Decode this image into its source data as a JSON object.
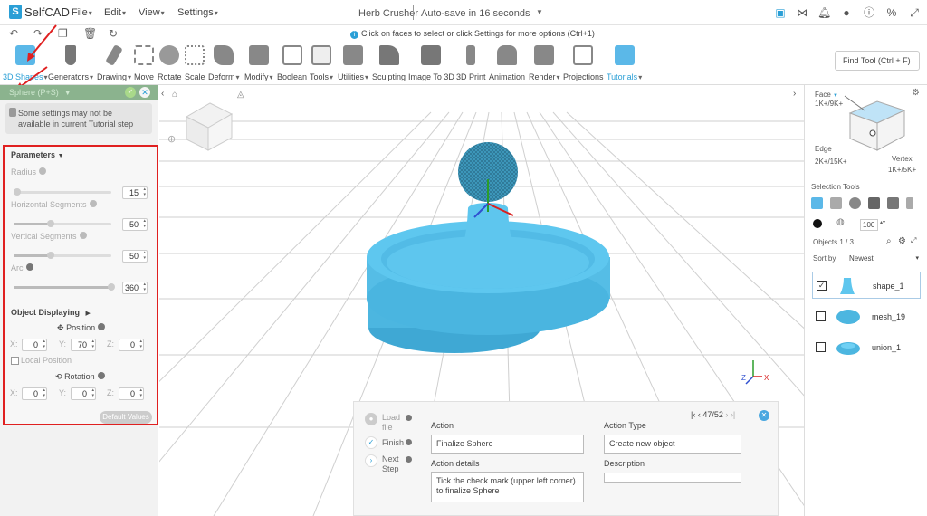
{
  "app": {
    "logo_text": "SelfCAD",
    "doc_title": "Herb Crusher",
    "autosave": "Auto-save in 16 seconds"
  },
  "menu": [
    "File",
    "Edit",
    "View",
    "Settings"
  ],
  "hint": "Click on faces to select or click Settings for more options (Ctrl+1)",
  "toolbar": {
    "tools": [
      "3D Shapes",
      "Generators",
      "Drawing",
      "Move",
      "Rotate",
      "Scale",
      "Deform",
      "Modify",
      "Boolean",
      "Tools",
      "Utilities",
      "Sculpting",
      "Image To 3D",
      "3D Print",
      "Animation",
      "Render",
      "Projections",
      "Tutorials"
    ],
    "find_tool": "Find Tool (Ctrl + F)"
  },
  "panel": {
    "title": "Sphere (P+S)",
    "notice": "Some settings may not be available in current Tutorial step",
    "parameters_title": "Parameters",
    "radius_label": "Radius",
    "radius": "15",
    "radius_level": 0.04,
    "hseg_label": "Horizontal Segments",
    "hseg": "50",
    "hseg_level": 0.38,
    "vseg_label": "Vertical Segments",
    "vseg": "50",
    "vseg_level": 0.38,
    "arc_label": "Arc",
    "arc": "360",
    "arc_level": 1.0,
    "object_displaying": "Object Displaying",
    "position_label": "Position",
    "pos_x": "0",
    "pos_y": "70",
    "pos_z": "0",
    "local_position": "Local Position",
    "rotation_label": "Rotation",
    "rot_x": "0",
    "rot_y": "0",
    "rot_z": "0",
    "default_values": "Default Values",
    "x": "X:",
    "y": "Y:",
    "z": "Z:"
  },
  "right": {
    "face": "Face",
    "face_count": "1K+/9K+",
    "edge": "Edge",
    "edge_count": "2K+/15K+",
    "vertex": "Vertex",
    "vertex_count": "1K+/5K+",
    "selection_tools": "Selection Tools",
    "opacity": "100",
    "objects": "Objects 1 / 3",
    "sort_by": "Sort by",
    "sort_value": "Newest",
    "items": [
      {
        "name": "shape_1",
        "checked": true
      },
      {
        "name": "mesh_19",
        "checked": false
      },
      {
        "name": "union_1",
        "checked": false
      }
    ]
  },
  "tutorial": {
    "steps": [
      "Load file",
      "Finish",
      "Next Step"
    ],
    "action_label": "Action",
    "action": "Finalize Sphere",
    "action_details_label": "Action details",
    "action_details": "Tick the check mark (upper left corner) to finalize Sphere",
    "action_type_label": "Action Type",
    "action_type": "Create new object",
    "description_label": "Description",
    "description": "",
    "page": "47/52"
  },
  "colors": {
    "accent": "#2a9fd6",
    "model": "#5bc0e8",
    "panel_header": "#8bb38e",
    "highlight": "#e02020"
  }
}
